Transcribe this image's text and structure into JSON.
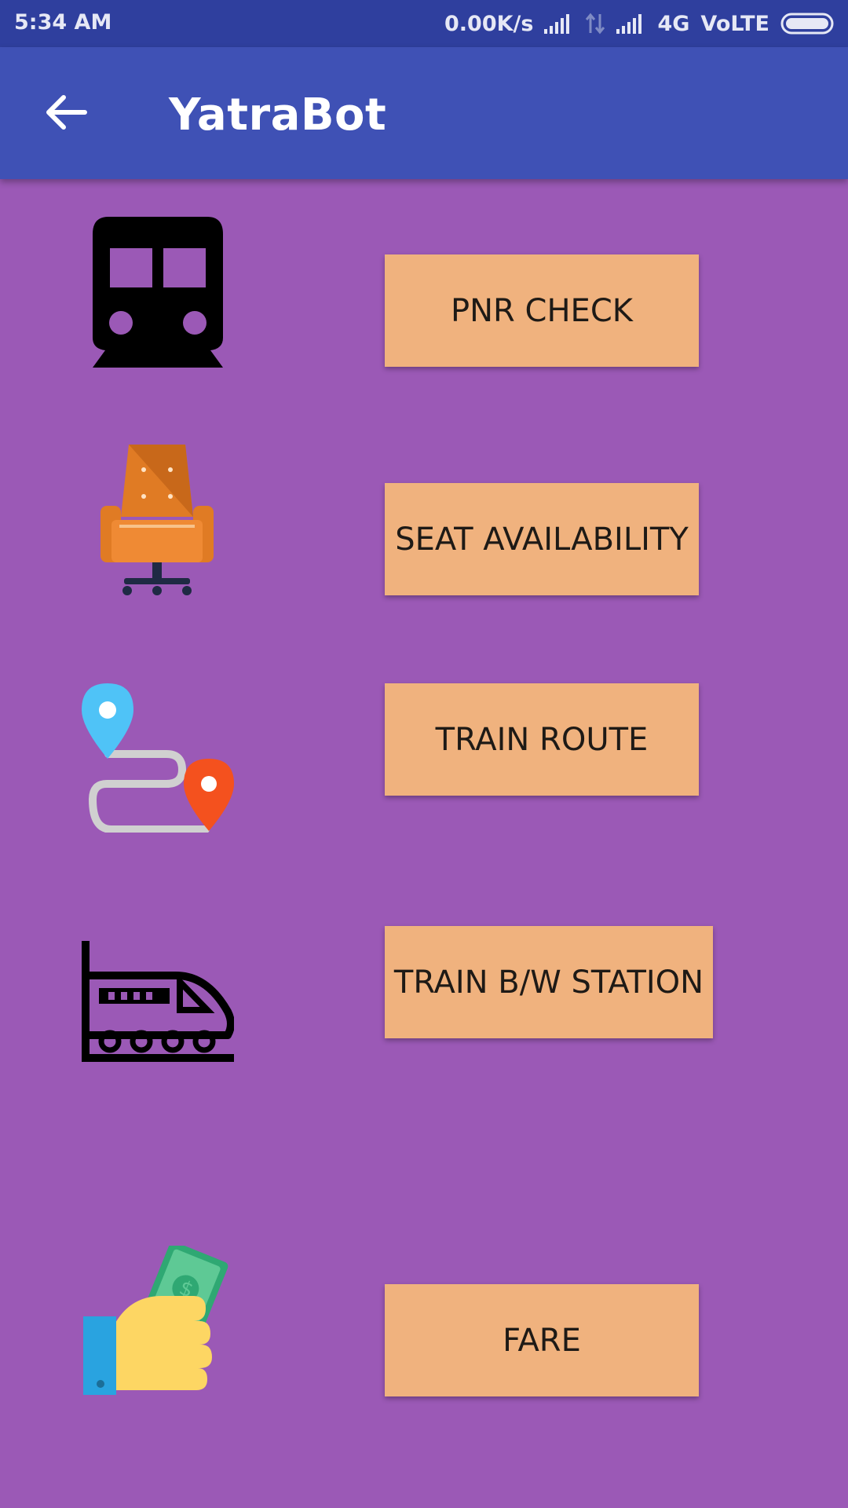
{
  "status_bar": {
    "time": "5:34 AM",
    "net_speed": "0.00K/s",
    "network_type": "4G",
    "volte": "VoLTE",
    "icons": [
      "signal-icon",
      "data-arrows-icon",
      "signal-icon",
      "battery-icon"
    ]
  },
  "app_bar": {
    "title": "YatraBot",
    "back_icon": "arrow-left-icon",
    "color": "#3f51b5"
  },
  "colors": {
    "background": "#9b59b6",
    "button": "#f0b27e",
    "status_bar": "#2f3f9e"
  },
  "menu": {
    "items": [
      {
        "label": "PNR CHECK",
        "icon": "train-front-icon"
      },
      {
        "label": "SEAT AVAILABILITY",
        "icon": "seat-chair-icon"
      },
      {
        "label": "TRAIN ROUTE",
        "icon": "route-map-icon"
      },
      {
        "label": "TRAIN B/W STATION",
        "icon": "bullet-train-icon"
      },
      {
        "label": "FARE",
        "icon": "money-hand-icon"
      }
    ]
  }
}
